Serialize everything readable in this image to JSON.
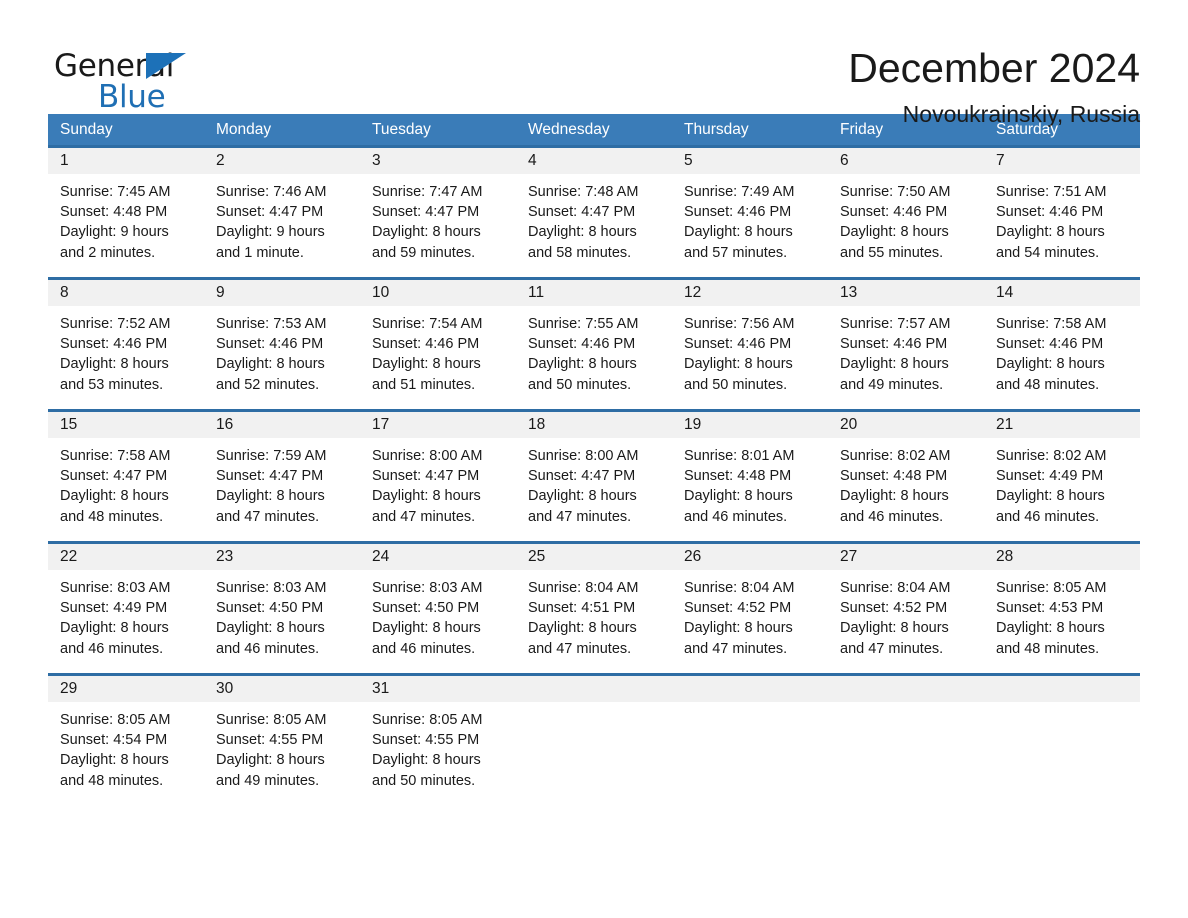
{
  "brand": {
    "name_top": "General",
    "name_bottom": "Blue",
    "triangle_color": "#1d71b8",
    "text_color": "#1f6fb4"
  },
  "header": {
    "title": "December 2024",
    "subtitle": "Novoukrainskiy, Russia"
  },
  "theme": {
    "header_row_bg": "#3a7cb8",
    "week_divider": "#2e6da4",
    "day_band_bg": "#f1f1f1",
    "text": "#1a1a1a"
  },
  "weekdays": [
    "Sunday",
    "Monday",
    "Tuesday",
    "Wednesday",
    "Thursday",
    "Friday",
    "Saturday"
  ],
  "weeks": [
    [
      {
        "day": "1",
        "lines": [
          "Sunrise: 7:45 AM",
          "Sunset: 4:48 PM",
          "Daylight: 9 hours",
          "and 2 minutes."
        ]
      },
      {
        "day": "2",
        "lines": [
          "Sunrise: 7:46 AM",
          "Sunset: 4:47 PM",
          "Daylight: 9 hours",
          "and 1 minute."
        ]
      },
      {
        "day": "3",
        "lines": [
          "Sunrise: 7:47 AM",
          "Sunset: 4:47 PM",
          "Daylight: 8 hours",
          "and 59 minutes."
        ]
      },
      {
        "day": "4",
        "lines": [
          "Sunrise: 7:48 AM",
          "Sunset: 4:47 PM",
          "Daylight: 8 hours",
          "and 58 minutes."
        ]
      },
      {
        "day": "5",
        "lines": [
          "Sunrise: 7:49 AM",
          "Sunset: 4:46 PM",
          "Daylight: 8 hours",
          "and 57 minutes."
        ]
      },
      {
        "day": "6",
        "lines": [
          "Sunrise: 7:50 AM",
          "Sunset: 4:46 PM",
          "Daylight: 8 hours",
          "and 55 minutes."
        ]
      },
      {
        "day": "7",
        "lines": [
          "Sunrise: 7:51 AM",
          "Sunset: 4:46 PM",
          "Daylight: 8 hours",
          "and 54 minutes."
        ]
      }
    ],
    [
      {
        "day": "8",
        "lines": [
          "Sunrise: 7:52 AM",
          "Sunset: 4:46 PM",
          "Daylight: 8 hours",
          "and 53 minutes."
        ]
      },
      {
        "day": "9",
        "lines": [
          "Sunrise: 7:53 AM",
          "Sunset: 4:46 PM",
          "Daylight: 8 hours",
          "and 52 minutes."
        ]
      },
      {
        "day": "10",
        "lines": [
          "Sunrise: 7:54 AM",
          "Sunset: 4:46 PM",
          "Daylight: 8 hours",
          "and 51 minutes."
        ]
      },
      {
        "day": "11",
        "lines": [
          "Sunrise: 7:55 AM",
          "Sunset: 4:46 PM",
          "Daylight: 8 hours",
          "and 50 minutes."
        ]
      },
      {
        "day": "12",
        "lines": [
          "Sunrise: 7:56 AM",
          "Sunset: 4:46 PM",
          "Daylight: 8 hours",
          "and 50 minutes."
        ]
      },
      {
        "day": "13",
        "lines": [
          "Sunrise: 7:57 AM",
          "Sunset: 4:46 PM",
          "Daylight: 8 hours",
          "and 49 minutes."
        ]
      },
      {
        "day": "14",
        "lines": [
          "Sunrise: 7:58 AM",
          "Sunset: 4:46 PM",
          "Daylight: 8 hours",
          "and 48 minutes."
        ]
      }
    ],
    [
      {
        "day": "15",
        "lines": [
          "Sunrise: 7:58 AM",
          "Sunset: 4:47 PM",
          "Daylight: 8 hours",
          "and 48 minutes."
        ]
      },
      {
        "day": "16",
        "lines": [
          "Sunrise: 7:59 AM",
          "Sunset: 4:47 PM",
          "Daylight: 8 hours",
          "and 47 minutes."
        ]
      },
      {
        "day": "17",
        "lines": [
          "Sunrise: 8:00 AM",
          "Sunset: 4:47 PM",
          "Daylight: 8 hours",
          "and 47 minutes."
        ]
      },
      {
        "day": "18",
        "lines": [
          "Sunrise: 8:00 AM",
          "Sunset: 4:47 PM",
          "Daylight: 8 hours",
          "and 47 minutes."
        ]
      },
      {
        "day": "19",
        "lines": [
          "Sunrise: 8:01 AM",
          "Sunset: 4:48 PM",
          "Daylight: 8 hours",
          "and 46 minutes."
        ]
      },
      {
        "day": "20",
        "lines": [
          "Sunrise: 8:02 AM",
          "Sunset: 4:48 PM",
          "Daylight: 8 hours",
          "and 46 minutes."
        ]
      },
      {
        "day": "21",
        "lines": [
          "Sunrise: 8:02 AM",
          "Sunset: 4:49 PM",
          "Daylight: 8 hours",
          "and 46 minutes."
        ]
      }
    ],
    [
      {
        "day": "22",
        "lines": [
          "Sunrise: 8:03 AM",
          "Sunset: 4:49 PM",
          "Daylight: 8 hours",
          "and 46 minutes."
        ]
      },
      {
        "day": "23",
        "lines": [
          "Sunrise: 8:03 AM",
          "Sunset: 4:50 PM",
          "Daylight: 8 hours",
          "and 46 minutes."
        ]
      },
      {
        "day": "24",
        "lines": [
          "Sunrise: 8:03 AM",
          "Sunset: 4:50 PM",
          "Daylight: 8 hours",
          "and 46 minutes."
        ]
      },
      {
        "day": "25",
        "lines": [
          "Sunrise: 8:04 AM",
          "Sunset: 4:51 PM",
          "Daylight: 8 hours",
          "and 47 minutes."
        ]
      },
      {
        "day": "26",
        "lines": [
          "Sunrise: 8:04 AM",
          "Sunset: 4:52 PM",
          "Daylight: 8 hours",
          "and 47 minutes."
        ]
      },
      {
        "day": "27",
        "lines": [
          "Sunrise: 8:04 AM",
          "Sunset: 4:52 PM",
          "Daylight: 8 hours",
          "and 47 minutes."
        ]
      },
      {
        "day": "28",
        "lines": [
          "Sunrise: 8:05 AM",
          "Sunset: 4:53 PM",
          "Daylight: 8 hours",
          "and 48 minutes."
        ]
      }
    ],
    [
      {
        "day": "29",
        "lines": [
          "Sunrise: 8:05 AM",
          "Sunset: 4:54 PM",
          "Daylight: 8 hours",
          "and 48 minutes."
        ]
      },
      {
        "day": "30",
        "lines": [
          "Sunrise: 8:05 AM",
          "Sunset: 4:55 PM",
          "Daylight: 8 hours",
          "and 49 minutes."
        ]
      },
      {
        "day": "31",
        "lines": [
          "Sunrise: 8:05 AM",
          "Sunset: 4:55 PM",
          "Daylight: 8 hours",
          "and 50 minutes."
        ]
      },
      {
        "day": "",
        "lines": []
      },
      {
        "day": "",
        "lines": []
      },
      {
        "day": "",
        "lines": []
      },
      {
        "day": "",
        "lines": []
      }
    ]
  ]
}
